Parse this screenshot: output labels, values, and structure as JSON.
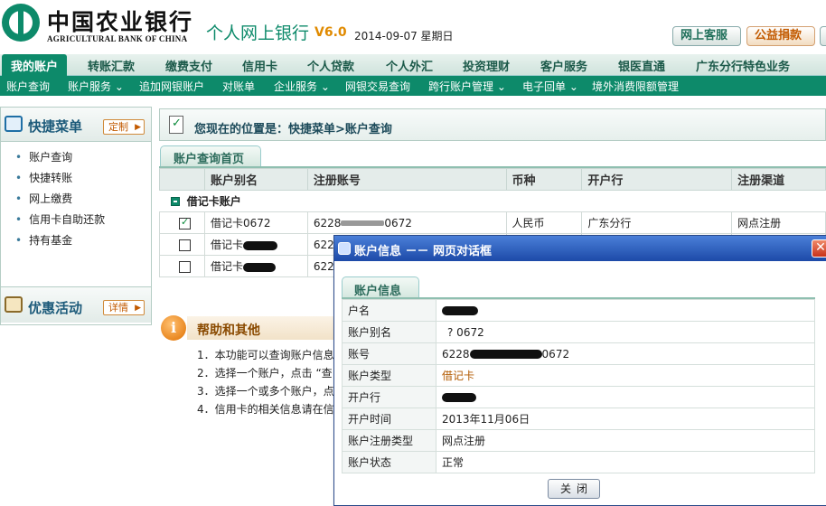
{
  "header": {
    "bank_name_cn": "中国农业银行",
    "bank_name_en": "AGRICULTURAL BANK OF CHINA",
    "system_name": "个人网上银行",
    "version": "V6.0",
    "date": "2014-09-07 星期日",
    "btn_customer_service": "网上客服",
    "btn_charity": "公益捐款"
  },
  "main_nav": [
    "我的账户",
    "转账汇款",
    "缴费支付",
    "信用卡",
    "个人贷款",
    "个人外汇",
    "投资理财",
    "客户服务",
    "银医直通",
    "广东分行特色业务"
  ],
  "sub_nav": [
    "账户查询",
    "账户服务 ⌄",
    "追加网银账户",
    "对账单",
    "企业服务 ⌄",
    "网银交易查询",
    "跨行账户管理 ⌄",
    "电子回单 ⌄",
    "境外消费限额管理"
  ],
  "left_panel": {
    "title": "快捷菜单",
    "customize": "定制",
    "items": [
      "账户查询",
      "快捷转账",
      "网上缴费",
      "信用卡自助还款",
      "持有基金"
    ],
    "promo_title": "优惠活动",
    "details": "详情"
  },
  "location": "您现在的位置是：快捷菜单>账户查询",
  "tab_label": "账户查询首页",
  "account_table": {
    "headers": [
      "",
      "账户别名",
      "注册账号",
      "币种",
      "开户行",
      "注册渠道"
    ],
    "group": "借记卡账户",
    "rows": [
      {
        "alias": "借记卡0672",
        "account": "6228",
        "account_tail": "0672",
        "currency": "人民币",
        "branch": "广东分行",
        "channel": "网点注册",
        "checked": true
      },
      {
        "alias": "借记卡",
        "account": "622",
        "checked": false
      },
      {
        "alias": "借记卡",
        "account": "622",
        "checked": false
      }
    ]
  },
  "help": {
    "title": "帮助和其他",
    "items": [
      "1．本功能可以查询账户信息",
      "2．选择一个账户，点击 “查",
      "3．选择一个或多个账户，点",
      "4．信用卡的相关信息请在信"
    ]
  },
  "dialog": {
    "title": "账户信息 －－ 网页对话框",
    "tab": "账户信息",
    "fields": [
      {
        "label": "户名",
        "value": ""
      },
      {
        "label": "账户别名",
        "value": "?   0672"
      },
      {
        "label": "账号",
        "value": "6228",
        "value_tail": "0672"
      },
      {
        "label": "账户类型",
        "value": "借记卡"
      },
      {
        "label": "开户行",
        "value": ""
      },
      {
        "label": "开户时间",
        "value": "2013年11月06日"
      },
      {
        "label": "账户注册类型",
        "value": "网点注册"
      },
      {
        "label": "账户状态",
        "value": "正常"
      }
    ],
    "close_btn": "关闭"
  }
}
